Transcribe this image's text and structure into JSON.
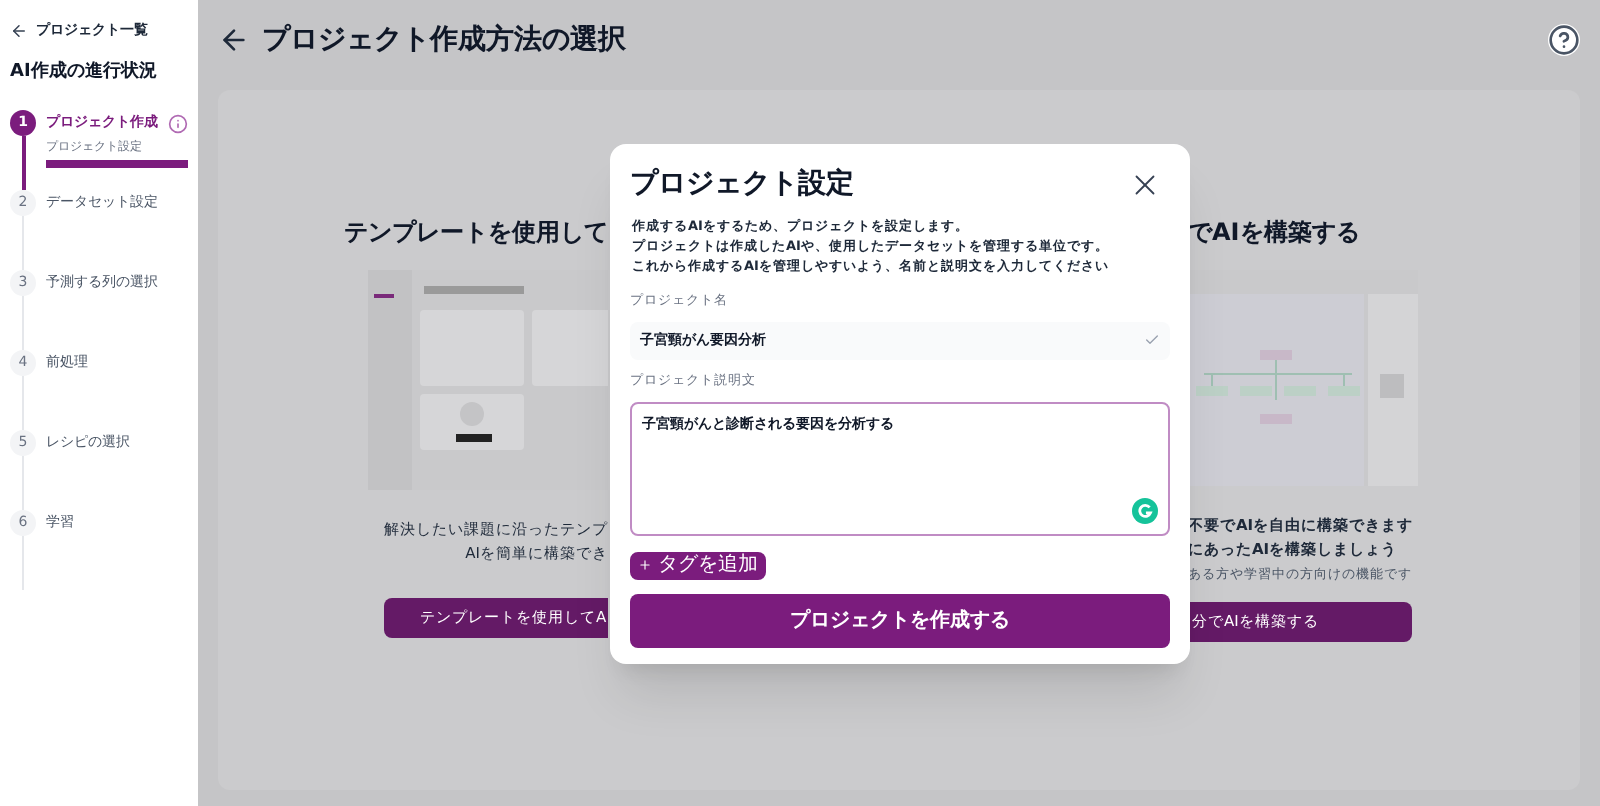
{
  "sidebar": {
    "back_link": "プロジェクト一覧",
    "title": "AI作成の進行状況",
    "steps": [
      {
        "number": "1",
        "label": "プロジェクト作成",
        "selected": true,
        "substep": "プロジェクト設定",
        "level": 1
      },
      {
        "number": "2",
        "label": "データセット設定",
        "selected": false
      },
      {
        "number": "3",
        "label": "予測する列の選択",
        "selected": false
      },
      {
        "number": "4",
        "label": "前処理",
        "selected": false
      },
      {
        "number": "5",
        "label": "レシピの選択",
        "selected": false
      },
      {
        "number": "6",
        "label": "学習",
        "selected": false
      }
    ]
  },
  "header": {
    "title": "プロジェクト作成方法の選択"
  },
  "options": [
    {
      "title": "テンプレートを使用して",
      "description": [
        "解決したい課題に沿ったテンプ",
        "AIを簡単に構築でき"
      ],
      "button": "テンプレートを使用してA"
    },
    {
      "title": "でAIを構築する",
      "description": [
        "不要でAIを自由に構築できます",
        "にあったAIを構築しましょう",
        "ある方や学習中の方向けの機能です"
      ],
      "button": "分でAIを構築する"
    }
  ],
  "dialog": {
    "title": "プロジェクト設定",
    "description": [
      "作成するAIをするため、プロジェクトを設定します。",
      "プロジェクトは作成したAIや、使用したデータセットを管理する単位です。",
      "これから作成するAIを管理しやすいよう、名前と説明文を入力してください"
    ],
    "name_label": "プロジェクト名",
    "name_value": "子宮頸がん要因分析",
    "description_label": "プロジェクト説明文",
    "description_value": "子宮頸がんと診断される要因を分析する",
    "tag_button": "タグを追加",
    "submit_button": "プロジェクトを作成する"
  }
}
